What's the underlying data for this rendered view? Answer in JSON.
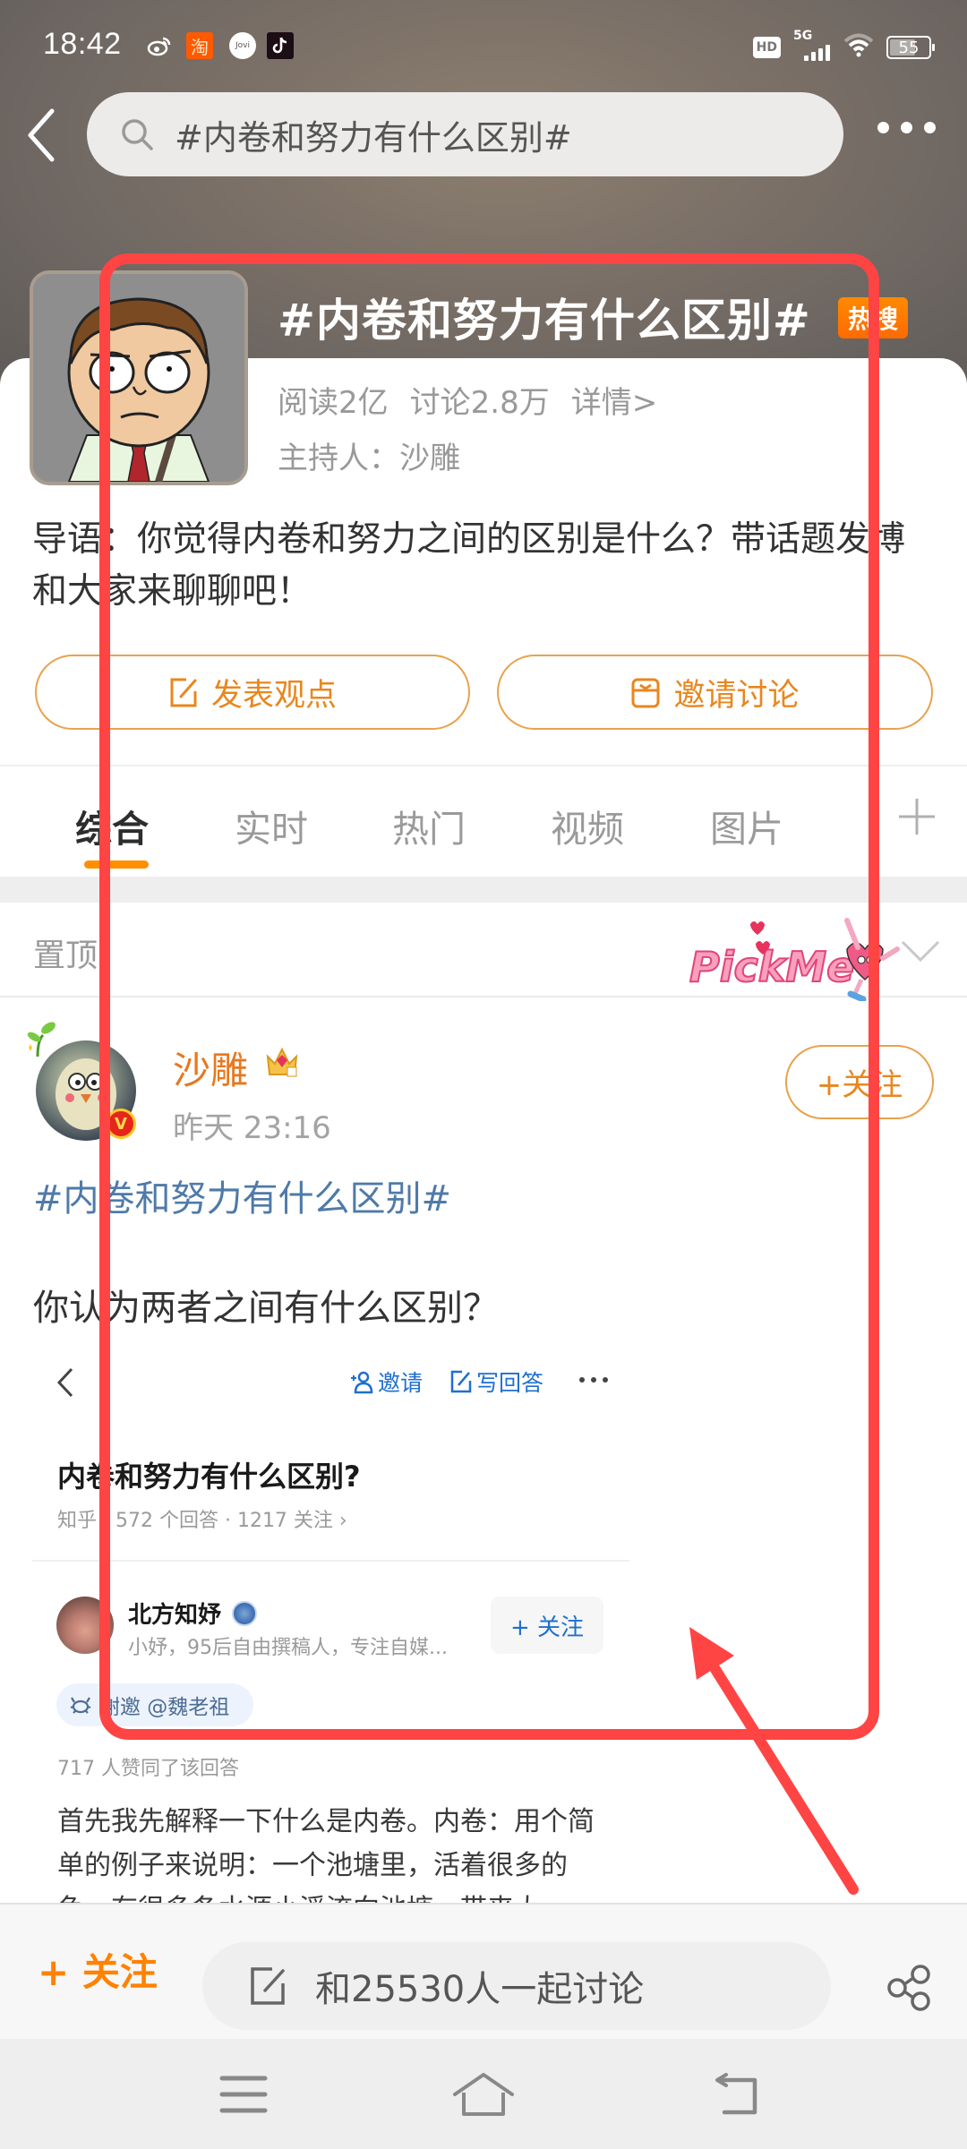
{
  "status_bar": {
    "time": "18:42",
    "notification_icons": [
      "weibo-icon",
      "taobao-icon",
      "jovi-icon",
      "tiktok-icon"
    ],
    "taobao_glyph": "淘",
    "jovi_label": "Jovi",
    "hd_label": "HD",
    "network": "5G",
    "battery": "55"
  },
  "header": {
    "search_query": "#内卷和努力有什么区别#"
  },
  "topic": {
    "title": "#内卷和努力有什么区别#",
    "hot_badge": "热搜",
    "reads": "阅读2亿",
    "discussions": "讨论2.8万",
    "details_link": "详情>",
    "host": "主持人：沙雕",
    "intro": "导语：你觉得内卷和努力之间的区别是什么？带话题发博和大家来聊聊吧！",
    "post_button": "发表观点",
    "invite_button": "邀请讨论"
  },
  "tabs": [
    {
      "label": "综合",
      "active": true
    },
    {
      "label": "实时",
      "active": false
    },
    {
      "label": "热门",
      "active": false
    },
    {
      "label": "视频",
      "active": false
    },
    {
      "label": "图片",
      "active": false
    }
  ],
  "pinned": {
    "label": "置顶",
    "sticker_text": "PickMe"
  },
  "post": {
    "author": "沙雕",
    "time": "昨天 23:16",
    "verified_glyph": "V",
    "follow_button": "+关注",
    "hashtag": "#内卷和努力有什么区别#",
    "body": "你认为两者之间有什么区别？",
    "embedded": {
      "invite": "邀请",
      "write_answer": "写回答",
      "question_title": "内卷和努力有什么区别?",
      "question_meta": "知乎 · 572 个回答 · 1217 关注 ›",
      "answer_author": "北方知妤",
      "answer_author_bio": "小妤，95后自由撰稿人，专注自媒...",
      "follow_button": "+ 关注",
      "thanks_tag": "谢邀 @魏老祖",
      "likes": "717 人赞同了该回答",
      "answer_text": "首先我先解释一下什么是内卷。内卷：用个简单的例子来说明：一个池塘里，活着很多的鱼，有很多条水源小溪流向池塘，带来大"
    }
  },
  "bottom_bar": {
    "follow_label": "+ 关注",
    "discuss_placeholder": "和25530人一起讨论"
  },
  "colors": {
    "accent_orange": "#e8871e",
    "hot_orange": "#ff8200",
    "hashtag_blue": "#4f7aa8",
    "zhihu_blue": "#1e6fd0",
    "annotation_red": "#ff4444"
  }
}
